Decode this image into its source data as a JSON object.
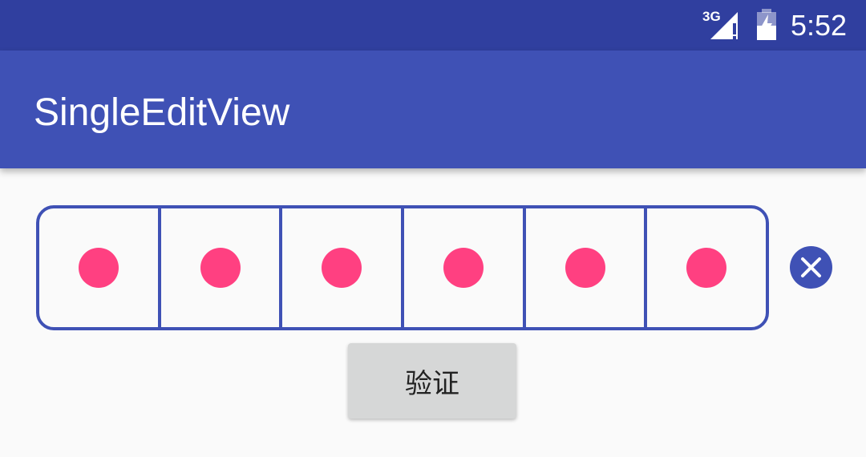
{
  "status_bar": {
    "network": "3G",
    "time": "5:52",
    "icons": [
      "signal-icon",
      "battery-charging-icon"
    ]
  },
  "app_bar": {
    "title": "SingleEditView"
  },
  "code_input": {
    "cells": [
      "●",
      "●",
      "●",
      "●",
      "●",
      "●"
    ],
    "filled_count": 6,
    "dot_color": "#ff4081",
    "border_color": "#3f51b5"
  },
  "clear_button": {
    "icon": "close-icon"
  },
  "verify_button": {
    "label": "验证"
  },
  "colors": {
    "primary": "#3f51b5",
    "primary_dark": "#303f9f",
    "accent": "#ff4081",
    "background": "#fafafa"
  }
}
